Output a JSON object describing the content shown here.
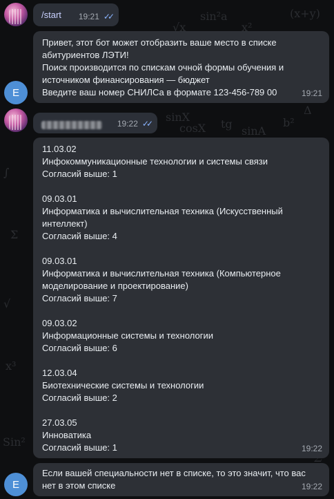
{
  "messages": [
    {
      "author": "user",
      "text": "/start",
      "time": "19:21",
      "read_icon": "double-check-icon"
    },
    {
      "author": "bot",
      "avatar_letter": "E",
      "time": "19:21",
      "lines": [
        "Привет, этот бот может отобразить ваше место в списке",
        "абитуриентов ЛЭТИ!",
        "Поиск производится по спискам очной формы обучения и",
        "источником финансирования — бюджет",
        "Введите ваш номер СНИЛСа в формате 123-456-789 00"
      ]
    },
    {
      "author": "user",
      "text_redacted": true,
      "time": "19:22",
      "read_icon": "double-check-icon"
    },
    {
      "author": "bot",
      "time": "19:22",
      "results": [
        {
          "code": "11.03.02",
          "name_lines": [
            "Инфокоммуникационные технологии и системы связи"
          ],
          "agree_label": "Согласий выше: 1"
        },
        {
          "code": "09.03.01",
          "name_lines": [
            "Информатика и вычислительная техника (Искусственный",
            "интеллект)"
          ],
          "agree_label": "Согласий выше: 4"
        },
        {
          "code": "09.03.01",
          "name_lines": [
            "Информатика и вычислительная техника (Компьютерное",
            "моделирование и проектирование)"
          ],
          "agree_label": "Согласий выше: 7"
        },
        {
          "code": "09.03.02",
          "name_lines": [
            "Информационные системы и технологии"
          ],
          "agree_label": "Согласий выше: 6"
        },
        {
          "code": "12.03.04",
          "name_lines": [
            "Биотехнические системы и технологии"
          ],
          "agree_label": "Согласий выше: 2"
        },
        {
          "code": "27.03.05",
          "name_lines": [
            "Инноватика"
          ],
          "agree_label": "Согласий выше: 1"
        }
      ]
    },
    {
      "author": "bot",
      "avatar_letter": "E",
      "time": "19:22",
      "lines": [
        "Если вашей специальности нет в списке, то это значит, что вас",
        "нет в этом списке"
      ]
    }
  ],
  "colors": {
    "bubble": "#2d3036",
    "avatar_bot": "#4e8fd6",
    "read_check": "#8ab4ff",
    "background": "#0e0f11"
  }
}
